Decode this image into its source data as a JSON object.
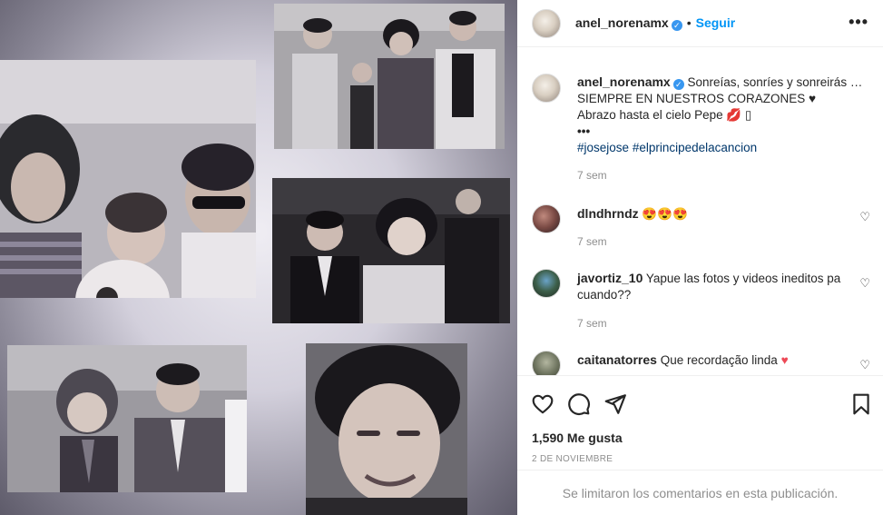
{
  "post": {
    "username": "anel_norenamx",
    "follow_label": "Seguir",
    "more_label": "•••",
    "caption_line1": "Sonreías, sonríes y sonreirás …",
    "caption_line2": "SIEMPRE EN NUESTROS CORAZONES ♥",
    "caption_line3": "Abrazo hasta el cielo Pepe 💋 ▯",
    "caption_more": "•••",
    "hashtag1": "#josejose",
    "hashtag2": "#elprincipedelacancion",
    "caption_time": "7 sem"
  },
  "comments": [
    {
      "username": "dlndhrndz",
      "text": "😍😍😍",
      "time": "7 sem"
    },
    {
      "username": "javortiz_10",
      "text": "Yapue las fotos y videos ineditos pa cuando??",
      "time": "7 sem"
    },
    {
      "username": "caitanatorres",
      "text": "Que recordação linda",
      "heart": "♥"
    }
  ],
  "actions": {
    "likes": "1,590 Me gusta",
    "date": "2 DE NOVIEMBRE",
    "comments_disabled": "Se limitaron los comentarios en esta publicación."
  },
  "icons": {
    "like": "heart-outline-icon",
    "comment": "comment-bubble-icon",
    "share": "paper-plane-icon",
    "save": "bookmark-icon",
    "verified": "verified-badge-icon"
  },
  "colors": {
    "accent": "#0095f6",
    "verified": "#3897f0",
    "heart": "#ed4956",
    "muted": "#8e8e8e"
  }
}
